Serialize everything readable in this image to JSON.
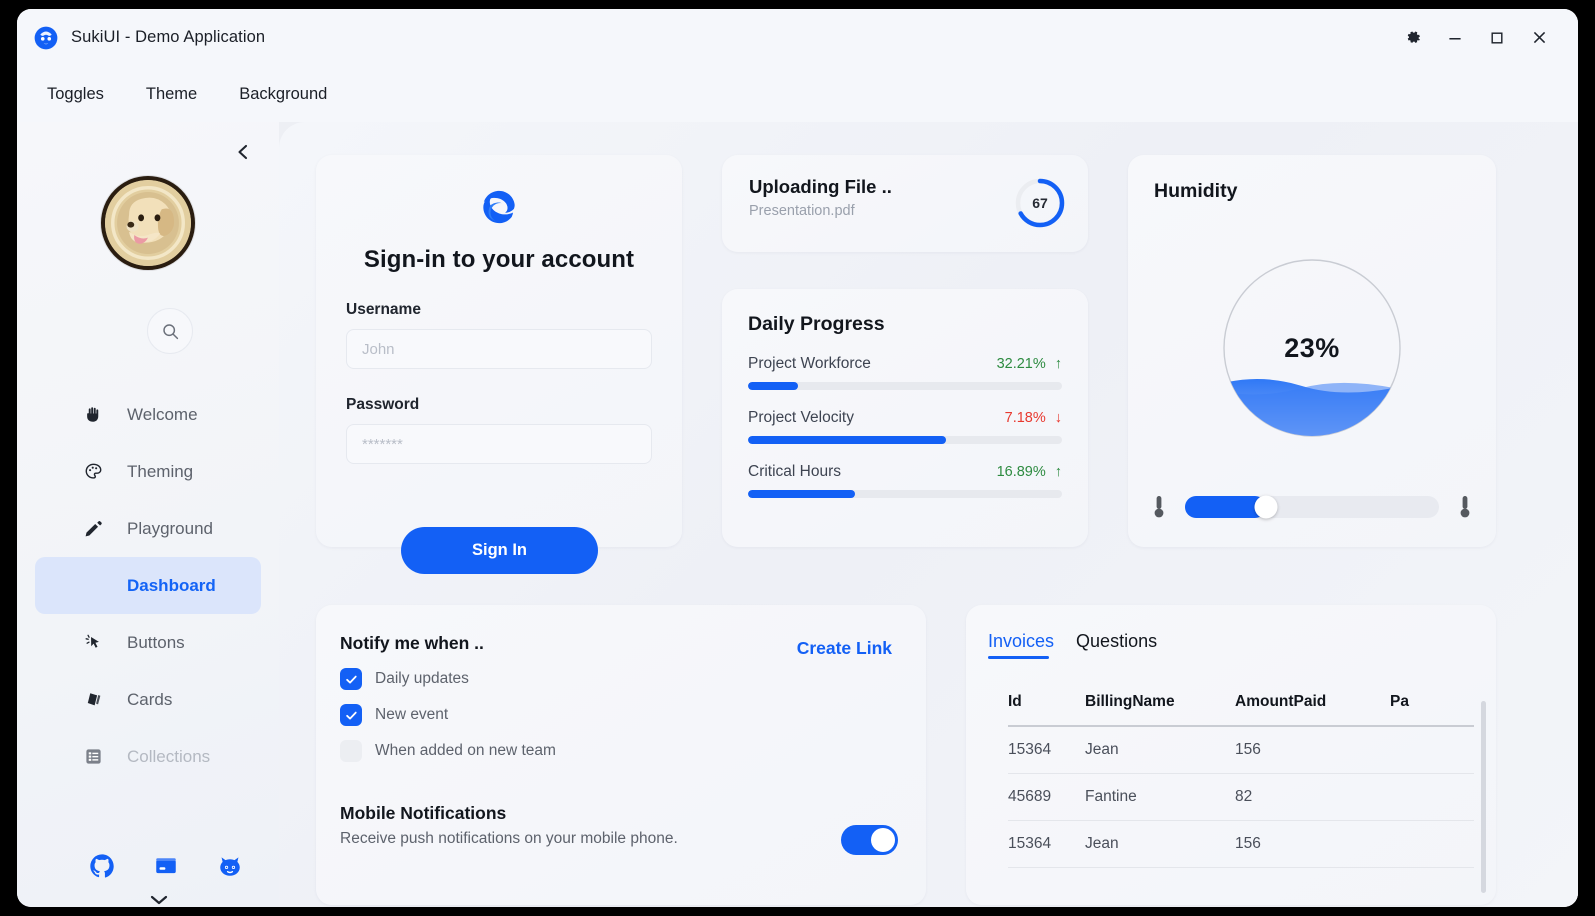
{
  "titlebar": {
    "app_title": "SukiUI - Demo Application",
    "logo_icon": "sukiui-logo-icon",
    "settings_icon": "gear-icon",
    "minimize_icon": "minimize-icon",
    "maximize_icon": "maximize-icon",
    "close_icon": "close-icon"
  },
  "menubar": {
    "items": [
      {
        "label": "Toggles"
      },
      {
        "label": "Theme"
      },
      {
        "label": "Background"
      }
    ]
  },
  "sidebar": {
    "collapse_icon": "chevron-left-icon",
    "avatar_icon": "dog-avatar",
    "search_icon": "search-icon",
    "scroll_more_icon": "chevron-down-icon",
    "items": [
      {
        "label": "Welcome",
        "icon": "hand-wave-icon",
        "active": false,
        "faded": false
      },
      {
        "label": "Theming",
        "icon": "palette-icon",
        "active": false,
        "faded": false
      },
      {
        "label": "Playground",
        "icon": "pencil-icon",
        "active": false,
        "faded": false
      },
      {
        "label": "Dashboard",
        "icon": "dashboard-icon",
        "active": true,
        "faded": false
      },
      {
        "label": "Buttons",
        "icon": "cursor-click-icon",
        "active": false,
        "faded": false
      },
      {
        "label": "Cards",
        "icon": "cards-icon",
        "active": false,
        "faded": false
      },
      {
        "label": "Collections",
        "icon": "list-icon",
        "active": false,
        "faded": true
      }
    ],
    "social": [
      {
        "name": "github-icon"
      },
      {
        "name": "nuget-package-icon"
      },
      {
        "name": "cat-icon"
      }
    ]
  },
  "signin": {
    "logo_icon": "edge-logo-icon",
    "title": "Sign-in to your account",
    "username_label": "Username",
    "username_value": "",
    "username_placeholder": "John",
    "password_label": "Password",
    "password_value": "",
    "password_placeholder": "*******",
    "button_label": "Sign In"
  },
  "upload": {
    "title": "Uploading File ..",
    "filename": "Presentation.pdf",
    "progress": 67,
    "progress_label": "67"
  },
  "daily_progress": {
    "title": "Daily Progress",
    "rows": [
      {
        "name": "Project Workforce",
        "value": "32.21%",
        "direction": "up",
        "arrow": "↑",
        "bar": 16
      },
      {
        "name": "Project Velocity",
        "value": "7.18%",
        "direction": "down",
        "arrow": "↓",
        "bar": 63
      },
      {
        "name": "Critical Hours",
        "value": "16.89%",
        "direction": "up",
        "arrow": "↑",
        "bar": 34
      }
    ]
  },
  "humidity": {
    "title": "Humidity",
    "value_label": "23%",
    "value": 23,
    "slider_value": 32,
    "left_icon": "thermometer-icon",
    "right_icon": "thermometer-icon"
  },
  "notify": {
    "title": "Notify me when ..",
    "create_link_label": "Create Link",
    "options": [
      {
        "label": "Daily updates",
        "checked": true
      },
      {
        "label": "New event",
        "checked": true
      },
      {
        "label": "When added on new team",
        "checked": false
      }
    ],
    "mobile_title": "Mobile Notifications",
    "mobile_desc": "Receive push notifications on your mobile phone.",
    "mobile_toggle_on": true
  },
  "invoices": {
    "tabs": [
      {
        "label": "Invoices",
        "active": true
      },
      {
        "label": "Questions",
        "active": false
      }
    ],
    "columns": [
      "Id",
      "BillingName",
      "AmountPaid",
      "Pa"
    ],
    "rows": [
      {
        "id": "15364",
        "billing_name": "Jean",
        "amount_paid": "156",
        "pa": ""
      },
      {
        "id": "45689",
        "billing_name": "Fantine",
        "amount_paid": "82",
        "pa": ""
      },
      {
        "id": "15364",
        "billing_name": "Jean",
        "amount_paid": "156",
        "pa": ""
      }
    ]
  },
  "colors": {
    "accent": "#1360f5",
    "accent_light": "#dbe5fb",
    "up": "#2d8b40",
    "down": "#e8392f",
    "window_bg": "#f4f6fa",
    "sidebar_bg": "#f3f5f9",
    "text": "#12161d",
    "muted": "#5d626c"
  }
}
